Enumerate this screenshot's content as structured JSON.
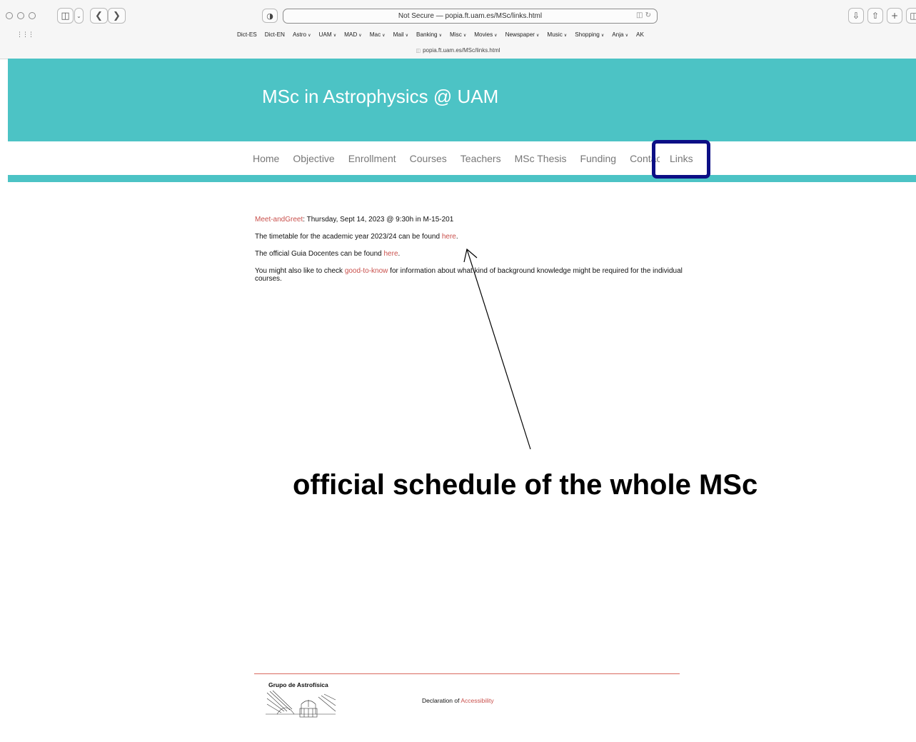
{
  "browser": {
    "address": "Not Secure — popia.ft.uam.es/MSc/links.html",
    "tab_title": "popia.ft.uam.es/MSc/links.html",
    "bookmarks": [
      {
        "label": "Dict-ES",
        "dropdown": false
      },
      {
        "label": "Dict-EN",
        "dropdown": false
      },
      {
        "label": "Astro",
        "dropdown": true
      },
      {
        "label": "UAM",
        "dropdown": true
      },
      {
        "label": "MAD",
        "dropdown": true
      },
      {
        "label": "Mac",
        "dropdown": true
      },
      {
        "label": "Mail",
        "dropdown": true
      },
      {
        "label": "Banking",
        "dropdown": true
      },
      {
        "label": "Misc",
        "dropdown": true
      },
      {
        "label": "Movies",
        "dropdown": true
      },
      {
        "label": "Newspaper",
        "dropdown": true
      },
      {
        "label": "Music",
        "dropdown": true
      },
      {
        "label": "Shopping",
        "dropdown": true
      },
      {
        "label": "Anja",
        "dropdown": true
      },
      {
        "label": "AK",
        "dropdown": false
      }
    ]
  },
  "site": {
    "title": "MSc in Astrophysics @ UAM",
    "nav": [
      "Home",
      "Objective",
      "Enrollment",
      "Courses",
      "Teachers",
      "MSc Thesis",
      "Funding"
    ],
    "nav_contact": "Contact",
    "nav_active": "Links"
  },
  "content": {
    "meet_link": "Meet-andGreet",
    "meet_text": ": Thursday, Sept 14, 2023 @ 9:30h in M-15-201",
    "timetable_text": "The timetable for the academic year 2023/24 can be found ",
    "timetable_link": "here",
    "guia_text": "The official Guia Docentes can be found ",
    "guia_link": "here",
    "check_text": "You might also like to check ",
    "check_link": "good-to-know",
    "check_rest": " for information about what kind of background knowledge might be required for the individual courses.",
    "period": "."
  },
  "annotation": "official schedule of the whole MSc",
  "footer": {
    "logo_text": "Grupo de Astrofísica",
    "access_text": "Declaration of ",
    "access_link": "Accessibility"
  },
  "colors": {
    "banner": "#4cc3c5",
    "link": "#c9504c",
    "highlight_box": "#0c0f85"
  }
}
